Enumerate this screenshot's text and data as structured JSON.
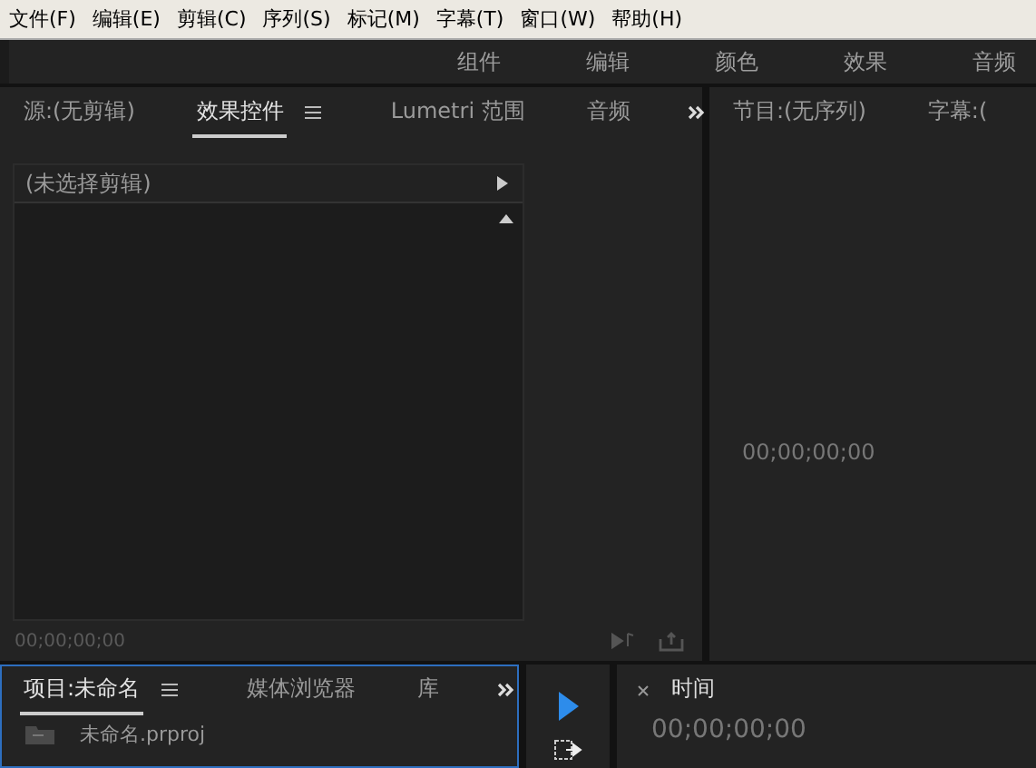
{
  "menu_bar": [
    "文件(F)",
    "编辑(E)",
    "剪辑(C)",
    "序列(S)",
    "标记(M)",
    "字幕(T)",
    "窗口(W)",
    "帮助(H)"
  ],
  "workspaces": [
    {
      "label": "组件",
      "selected": false
    },
    {
      "label": "编辑",
      "selected": false
    },
    {
      "label": "颜色",
      "selected": false
    },
    {
      "label": "效果",
      "selected": false
    },
    {
      "label": "音频",
      "selected": false
    }
  ],
  "source_panel": {
    "tabs": [
      {
        "label": "源:(无剪辑)",
        "selected": false,
        "menu": false
      },
      {
        "label": "效果控件",
        "selected": true,
        "menu": true
      },
      {
        "label": "Lumetri 范围",
        "selected": false,
        "menu": false
      },
      {
        "label": "音频",
        "selected": false,
        "menu": false
      }
    ],
    "clip_header": "(未选择剪辑)",
    "timecode": "00;00;00;00"
  },
  "program_panel": {
    "tabs": [
      {
        "label": "节目:(无序列)",
        "selected": false
      },
      {
        "label": "字幕:(",
        "selected": false
      }
    ],
    "timecode": "00;00;00;00"
  },
  "project_panel": {
    "focused": true,
    "tabs": [
      {
        "label": "项目:未命名",
        "selected": true,
        "menu": true
      },
      {
        "label": "媒体浏览器",
        "selected": false,
        "menu": false
      },
      {
        "label": "库",
        "selected": false,
        "menu": false
      }
    ],
    "items": [
      {
        "name": "未命名.prproj"
      }
    ]
  },
  "timeline_panel": {
    "title": "时间",
    "timecode": "00;00;00;00"
  }
}
